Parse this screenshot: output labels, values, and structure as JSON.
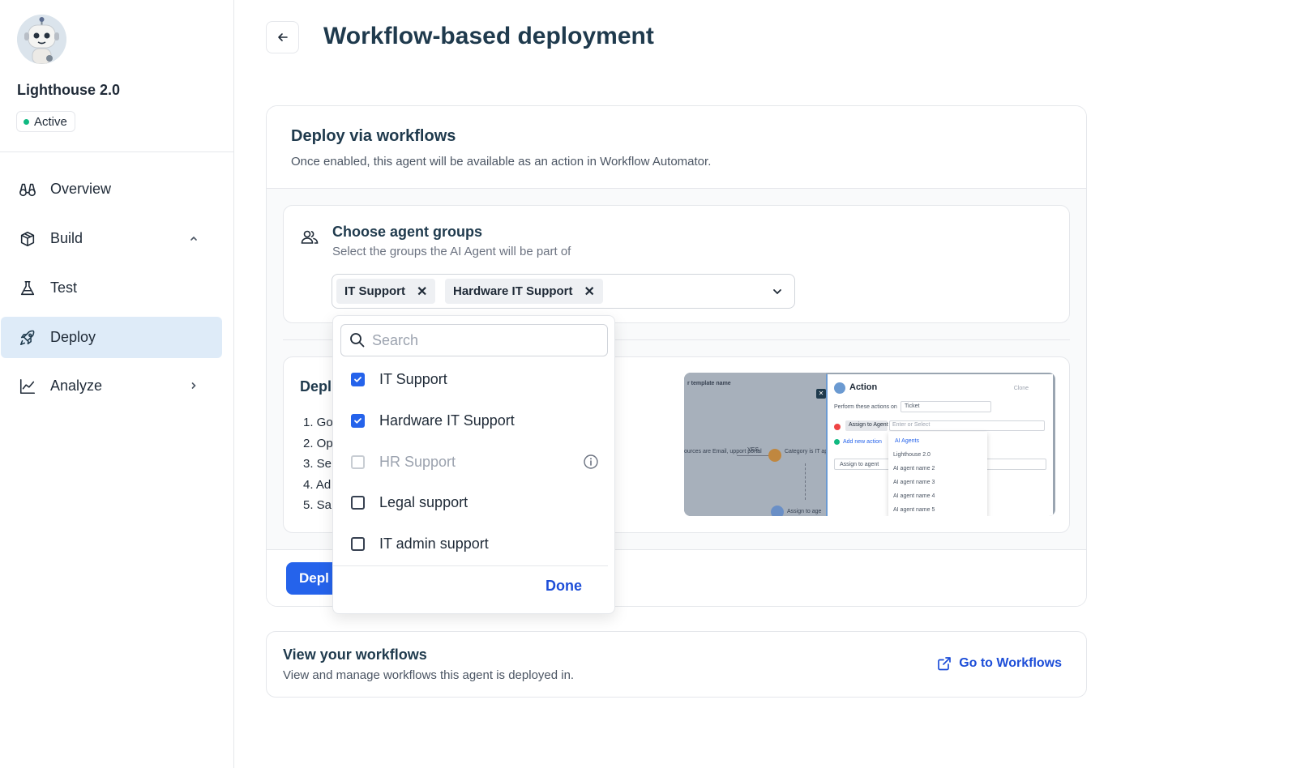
{
  "sidebar": {
    "agent_name": "Lighthouse 2.0",
    "status": "Active",
    "status_color": "#10b981",
    "active_bg": "#deebf8",
    "items": [
      {
        "label": "Overview",
        "icon": "binoculars-icon"
      },
      {
        "label": "Build",
        "icon": "box-icon",
        "chevron": "chevron-up-icon"
      },
      {
        "label": "Test",
        "icon": "flask-icon"
      },
      {
        "label": "Deploy",
        "icon": "rocket-icon",
        "active": true
      },
      {
        "label": "Analyze",
        "icon": "chart-line-icon",
        "chevron": "chevron-right-icon"
      }
    ]
  },
  "header": {
    "title": "Workflow-based deployment",
    "back_icon": "arrow-left-icon"
  },
  "deploy_card": {
    "title": "Deploy via workflows",
    "subtitle": "Once enabled, this agent will be available as an action in Workflow Automator.",
    "groups": {
      "title": "Choose agent groups",
      "subtitle": "Select the groups the AI Agent will be part of",
      "selected": [
        "IT Support",
        "Hardware IT Support"
      ]
    },
    "steps": {
      "title": "Depl",
      "items": [
        "1. Go",
        "2. Op",
        "3. Se",
        "4. Ad",
        "5. Sa"
      ]
    },
    "preview": {
      "template_label": "r template name",
      "action_title": "Action",
      "clone_label": "Clone",
      "perform_label": "Perform these actions on",
      "perform_value": "Ticket",
      "assign_chip": "Assign to Agent",
      "enter_select": "Enter or Select",
      "add_action": "Add new action",
      "assign_field": "Assign to agent",
      "back_agents": "AI Agents",
      "agent_list": [
        "Lighthouse 2.0",
        "AI agent name 2",
        "AI agent name 3",
        "AI agent name 4",
        "AI agent name 5"
      ],
      "flow_yes": "YES",
      "flow_left": "ources are Email, upport portal",
      "flow_right": "Category is IT applications, H",
      "flow_assign": "Assign to age"
    },
    "deploy_button": "Depl"
  },
  "dropdown": {
    "search_placeholder": "Search",
    "accent": "#2563eb",
    "options": [
      {
        "label": "IT Support",
        "checked": true,
        "disabled": false
      },
      {
        "label": "Hardware IT Support",
        "checked": true,
        "disabled": false
      },
      {
        "label": "HR Support",
        "checked": false,
        "disabled": true,
        "icon": "info-icon"
      },
      {
        "label": "Legal support",
        "checked": false,
        "disabled": false
      },
      {
        "label": "IT admin support",
        "checked": false,
        "disabled": false
      }
    ],
    "done_label": "Done"
  },
  "workflows_card": {
    "title": "View your workflows",
    "subtitle": "View and manage workflows this agent is deployed in.",
    "link_label": "Go to Workflows",
    "link_icon": "external-link-icon"
  }
}
